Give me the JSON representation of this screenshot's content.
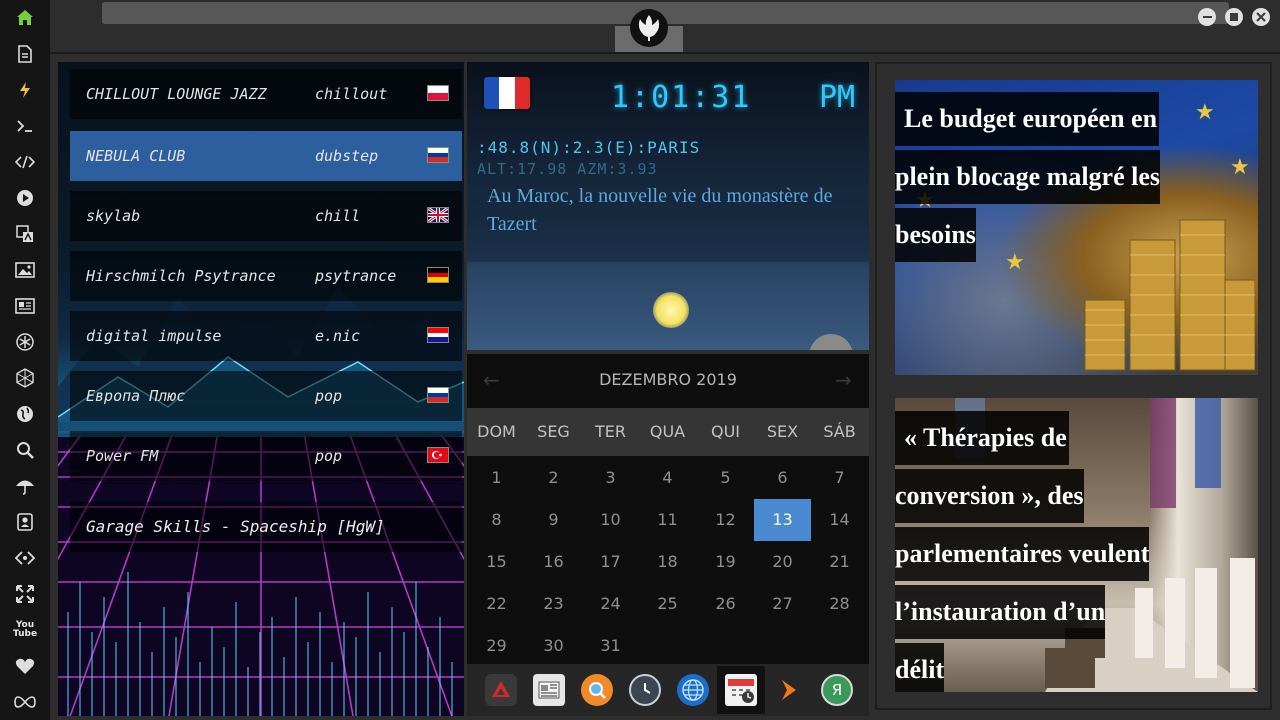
{
  "dock": {
    "icons": [
      "home-icon",
      "document-icon",
      "lightning-icon",
      "terminal-icon",
      "code-icon",
      "play-icon",
      "translate-icon",
      "image-icon",
      "news-icon",
      "asterisk-icon",
      "hexagon-icon",
      "globe-icon",
      "search-icon",
      "umbrella-icon",
      "contacts-icon",
      "tag-icon",
      "expand-icon",
      "youtube-icon",
      "heart-icon",
      "infinity-icon"
    ],
    "youtube_label": "You\nTube"
  },
  "radio": {
    "stations": [
      {
        "name": "CHILLOUT LOUNGE JAZZ",
        "genre": "chillout",
        "flag": "pl"
      },
      {
        "name": "NEBULA CLUB",
        "genre": "dubstep",
        "flag": "ru"
      },
      {
        "name": "skylab",
        "genre": "chill",
        "flag": "gb"
      },
      {
        "name": "Hirschmilch Psytrance",
        "genre": "psytrance",
        "flag": "de"
      },
      {
        "name": "digital impulse",
        "genre": "e.nic",
        "flag": "hr"
      },
      {
        "name": "Европа Плюс",
        "genre": "pop",
        "flag": "ru"
      },
      {
        "name": "Power FM",
        "genre": "pop",
        "flag": "tr"
      }
    ],
    "active_index": 1,
    "now_playing": "Garage Skills - Spaceship [HgW]"
  },
  "clock": {
    "time": "1:01:31",
    "ampm": "PM",
    "coords": ":48.8(N):2.3(E):PARIS",
    "altazm": "ALT:17.98 AZM:3.93",
    "news": "Au Maroc, la nouvelle vie du monastère de Tazert"
  },
  "calendar": {
    "month": "DEZEMBRO 2019",
    "weekdays": [
      "DOM",
      "SEG",
      "TER",
      "QUA",
      "QUI",
      "SEX",
      "SÁB"
    ],
    "days": [
      "1",
      "2",
      "3",
      "4",
      "5",
      "6",
      "7",
      "8",
      "9",
      "10",
      "11",
      "12",
      "13",
      "14",
      "15",
      "16",
      "17",
      "18",
      "19",
      "20",
      "21",
      "22",
      "23",
      "24",
      "25",
      "26",
      "27",
      "28",
      "29",
      "30",
      "31"
    ],
    "today": "13"
  },
  "apps": [
    "launcher-app-icon",
    "newspaper-app-icon",
    "search-app-icon",
    "clock-app-icon",
    "globe-app-icon",
    "calendar-app-icon",
    "arrow-app-icon",
    "yandex-app-icon"
  ],
  "apps_text": {
    "yandex": "Я"
  },
  "news": {
    "headline1": [
      "Le budget européen en",
      "plein blocage malgré les",
      "besoins"
    ],
    "headline2": [
      "« Thérapies de",
      "conversion », des",
      "parlementaires veulent",
      "l’instauration d’un",
      "délit"
    ]
  }
}
